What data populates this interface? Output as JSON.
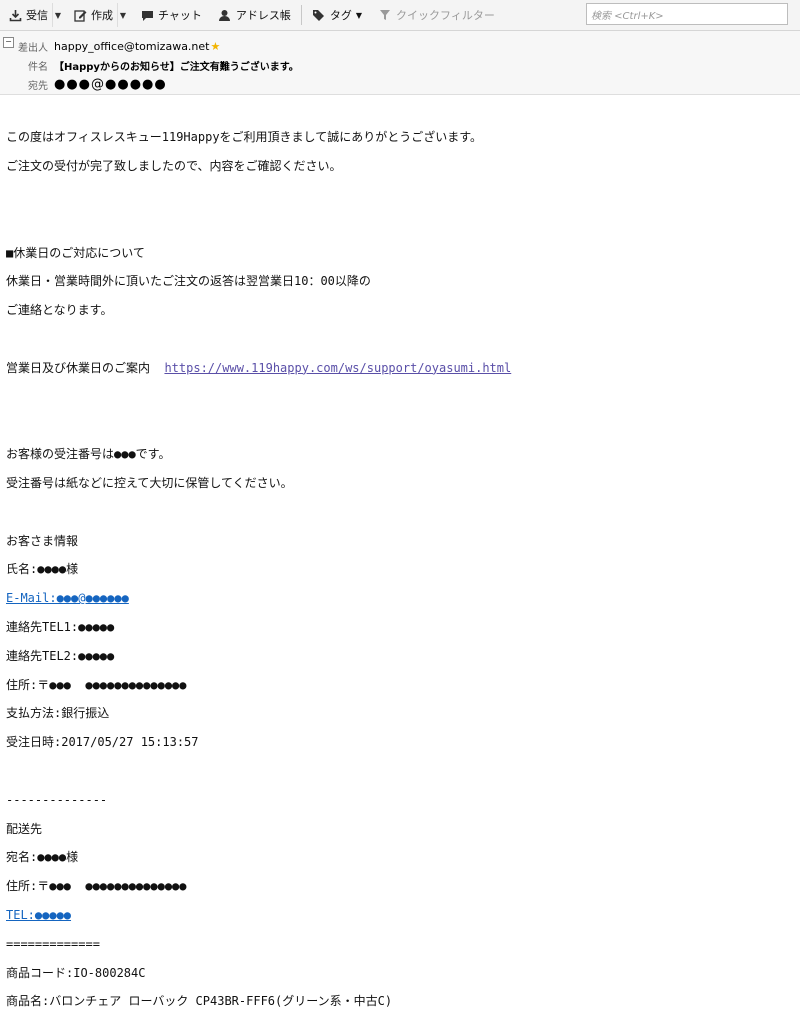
{
  "toolbar": {
    "receive_label": "受信",
    "compose_label": "作成",
    "chat_label": "チャット",
    "addressbook_label": "アドレス帳",
    "tag_label": "タグ",
    "quickfilter_label": "クイックフィルター",
    "search_placeholder": "検索 <Ctrl+K>"
  },
  "header": {
    "from_label": "差出人",
    "from_value": "happy_office@tomizawa.net",
    "subject_label": "件名",
    "subject_value": "【Happyからのお知らせ】ご注文有難うございます。",
    "to_label": "宛先",
    "to_value": "●●●@●●●●●"
  },
  "message": {
    "l1": "この度はオフィスレスキュー119Happyをご利用頂きまして誠にありがとうございます。",
    "l2": "ご注文の受付が完了致しましたので、内容をご確認ください。",
    "l3": "",
    "l4": "",
    "l5": "■休業日のご対応について",
    "l6": "休業日・営業時間外に頂いたご注文の返答は翌営業日10：00以降の",
    "l7": "ご連絡となります。",
    "l8": "",
    "l9_prefix": "営業日及び休業日のご案内  ",
    "l9_link": "https://www.119happy.com/ws/support/oyasumi.html",
    "l10": "",
    "l11": "",
    "l12": "お客様の受注番号は●●●です。",
    "l13": "受注番号は紙などに控えて大切に保管してください。",
    "l14": "",
    "l15": "お客さま情報",
    "l16": "氏名:●●●●様",
    "l17": "E-Mail:●●●@●●●●●●",
    "l18": "連絡先TEL1:●●●●●",
    "l19": "連絡先TEL2:●●●●●",
    "l20": "住所:〒●●●  ●●●●●●●●●●●●●●",
    "l21": "支払方法:銀行振込",
    "l22": "受注日時:2017/05/27 15:13:57",
    "l23": "",
    "l24": "--------------",
    "l25": "配送先",
    "l26": "宛名:●●●●様",
    "l27": "住所:〒●●●  ●●●●●●●●●●●●●●",
    "l28": "TEL:●●●●●",
    "l29": "=============",
    "l30": "商品コード:IO-800284C",
    "l31": "商品名:バロンチェア ローバック CP43BR-FFF6(グリーン系・中古C)"
  },
  "colors": {
    "link": "#5a4fa8",
    "email_link": "#1565c0",
    "star": "#f2b400"
  }
}
